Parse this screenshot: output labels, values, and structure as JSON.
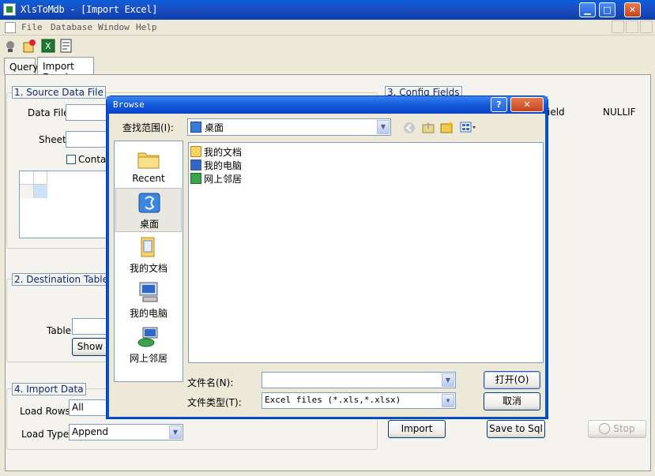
{
  "window": {
    "title": "XlsToMdb - [Import Excel]",
    "min": "▁",
    "max": "□",
    "close": "✕"
  },
  "menu": [
    "File",
    "Database",
    "Window",
    "Help"
  ],
  "tabs": [
    "Query",
    "Import Excel"
  ],
  "source": {
    "group_label": "1. Source Data File",
    "data_file_label": "Data File",
    "sheet_label": "Sheet",
    "contains_label": "Contain"
  },
  "config": {
    "group_label": "3. Config Fields",
    "col_field": "ield",
    "col_nullif": "NULLIF"
  },
  "destination": {
    "group_label": "2. Destination Table",
    "table_label": "Table",
    "show_label": "Show"
  },
  "import_data": {
    "group_label": "4. Import Data",
    "load_rows_label": "Load Rows",
    "load_rows_value": "All",
    "load_type_label": "Load Type",
    "load_type_value": "Append"
  },
  "buttons": {
    "import": "Import",
    "save_sql": "Save to Sql",
    "stop": "Stop"
  },
  "dialog": {
    "title": "Browse",
    "help": "?",
    "close": "✕",
    "lookin_label": "查找范围(I):",
    "lookin_value": "桌面",
    "places": [
      {
        "label": "Recent",
        "icon": "folder-star-icon"
      },
      {
        "label": "桌面",
        "icon": "desktop-icon"
      },
      {
        "label": "我的文档",
        "icon": "my-documents-icon"
      },
      {
        "label": "我的电脑",
        "icon": "my-computer-icon"
      },
      {
        "label": "网上邻居",
        "icon": "network-places-icon"
      }
    ],
    "files": [
      "我的文档",
      "我的电脑",
      "网上邻居"
    ],
    "filename_label": "文件名(N):",
    "filename_value": "",
    "filetype_label": "文件类型(T):",
    "filetype_value": "Excel files (*.xls,*.xlsx)",
    "open_label": "打开(O)",
    "cancel_label": "取消"
  },
  "colors": {
    "accent": "#0a52d0",
    "face": "#ece9d8"
  }
}
